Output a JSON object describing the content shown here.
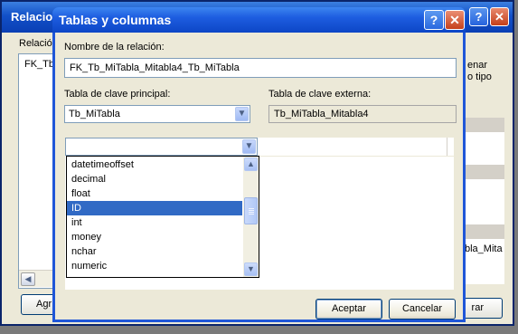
{
  "background_window": {
    "title": "Relacio",
    "relation_label": "Relació",
    "list_item": "FK_Tb",
    "right_text_1": "enar",
    "right_text_2": "o tipo",
    "grid_text": "bla_Mita",
    "add_button": "Agr",
    "close_button": "rar",
    "help_glyph": "?",
    "close_glyph": "✕"
  },
  "dialog": {
    "title": "Tablas y columnas",
    "help_glyph": "?",
    "close_glyph": "✕",
    "relation_name_label": "Nombre de la relación:",
    "relation_name_value": "FK_Tb_MiTabla_Mitabla4_Tb_MiTabla",
    "primary_key_table_label": "Tabla de clave principal:",
    "primary_key_table_value": "Tb_MiTabla",
    "foreign_key_table_label": "Tabla de clave externa:",
    "foreign_key_table_value": "Tb_MiTabla_Mitabla4",
    "column_combo_value": "",
    "dropdown_items": [
      "datetimeoffset",
      "decimal",
      "float",
      "ID",
      "int",
      "money",
      "nchar",
      "numeric"
    ],
    "selected_item": "ID",
    "ok_button": "Aceptar",
    "cancel_button": "Cancelar"
  },
  "icons": {
    "combo_arrow": "chevron-down-icon",
    "scroll_up": "chevron-up-icon",
    "scroll_down": "chevron-down-icon",
    "scroll_left": "chevron-left-icon"
  },
  "colors": {
    "titlebar": "#0a3fb4",
    "selection": "#316ac5",
    "window_face": "#ece9d8"
  }
}
